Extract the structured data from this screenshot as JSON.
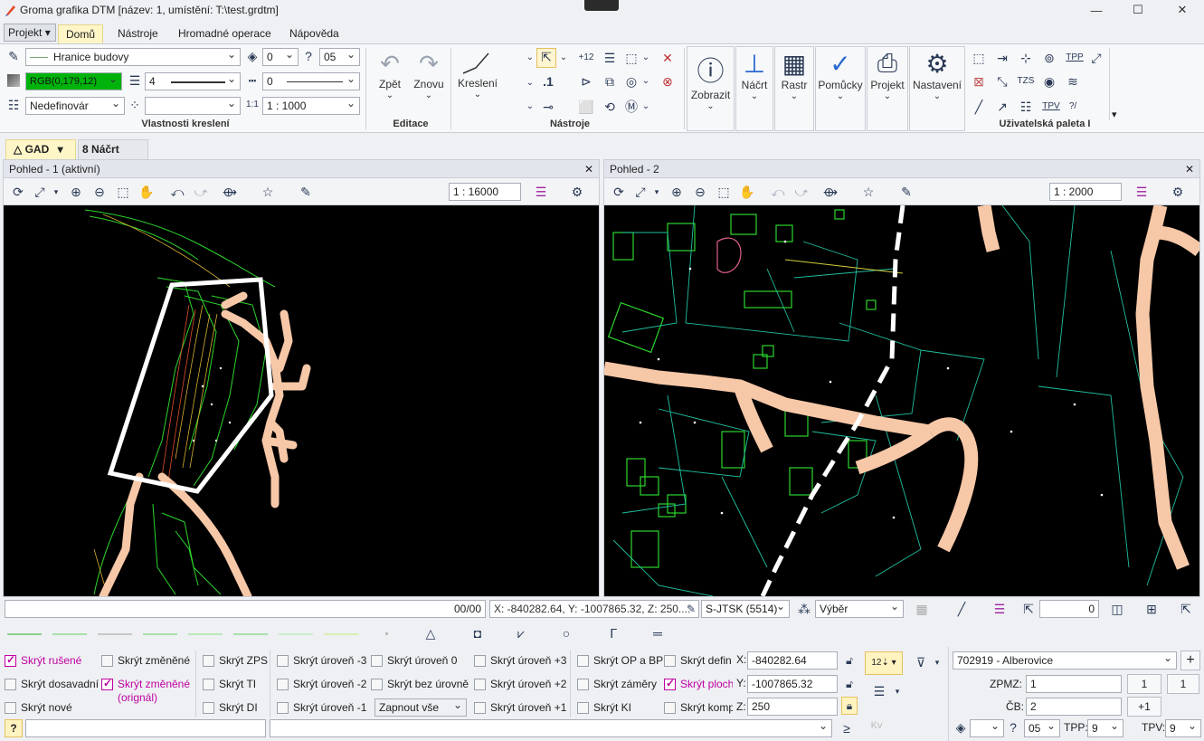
{
  "window": {
    "title": "Groma grafika DTM [název: 1, umístění: T:\\test.grdtm]",
    "minimize_icon": "minimize-icon",
    "maximize_icon": "maximize-icon",
    "close_icon": "close-icon"
  },
  "menu": {
    "projekt": "Projekt",
    "tabs": [
      "Domů",
      "Nástroje",
      "Hromadné operace",
      "Nápověda"
    ],
    "active_tab": "Domů"
  },
  "ribbon": {
    "drawing_props": {
      "layer": "Hranice budovy",
      "color": "RGB(0,179,12)",
      "color_hex": "#00b30c",
      "line_width": "4",
      "fill": "Nedefinovár",
      "num1": "0",
      "num2": "05",
      "num3": "0",
      "scale": "1 : 1000",
      "group_label": "Vlastnosti kreslení"
    },
    "editing": {
      "undo": "Zpět",
      "redo": "Znovu",
      "group_label": "Editace"
    },
    "drawing": {
      "kresleni": "Kreslení"
    },
    "tools": {
      "group_label": "Nástroje"
    },
    "big_buttons": [
      "Zobrazit",
      "Náčrt",
      "Rastr",
      "Pomůcky",
      "Projekt",
      "Nastavení"
    ],
    "palette": {
      "group_label": "Uživatelská paleta I",
      "tpp": "TPP",
      "tpv": "TPV"
    }
  },
  "doc_tabs": [
    "GAD",
    "Náčrt"
  ],
  "views": [
    {
      "title": "Pohled - 1 (aktivní)",
      "scale": "1 : 16000"
    },
    {
      "title": "Pohled - 2",
      "scale": "1 : 2000"
    }
  ],
  "status": {
    "counter": "00/00",
    "coords": "X: -840282.64, Y: -1007865.32, Z: 250....",
    "crs": "S-JTSK (5514)",
    "mode": "Výběr",
    "count": "0"
  },
  "filters": {
    "col1": [
      {
        "label": "Skrýt rušené",
        "checked": true
      },
      {
        "label": "Skrýt dosavadní",
        "checked": false
      },
      {
        "label": "Skrýt nové",
        "checked": false
      }
    ],
    "col2": [
      {
        "label": "Skrýt změněné",
        "checked": false
      },
      {
        "label": "Skrýt změněné (orignál)",
        "checked": true
      }
    ],
    "col3": [
      {
        "label": "Skrýt ZPS",
        "checked": false
      },
      {
        "label": "Skrýt TI",
        "checked": false
      },
      {
        "label": "Skrýt DI",
        "checked": false
      }
    ],
    "col4": [
      {
        "label": "Skrýt úroveň -3",
        "checked": false
      },
      {
        "label": "Skrýt úroveň -2",
        "checked": false
      },
      {
        "label": "Skrýt úroveň -1",
        "checked": false
      }
    ],
    "col5": [
      {
        "label": "Skrýt úroveň 0",
        "checked": false
      },
      {
        "label": "Skrýt bez úrovně",
        "checked": false
      }
    ],
    "zapnout": "Zapnout vše",
    "col6": [
      {
        "label": "Skrýt úroveň +3",
        "checked": false
      },
      {
        "label": "Skrýt úroveň +2",
        "checked": false
      },
      {
        "label": "Skrýt úroveň +1",
        "checked": false
      }
    ],
    "col7": [
      {
        "label": "Skrýt OP a BP",
        "checked": false
      },
      {
        "label": "Skrýt záměry",
        "checked": false
      },
      {
        "label": "Skrýt KI",
        "checked": false
      }
    ],
    "col8": [
      {
        "label": "Skrýt defin",
        "checked": false
      },
      {
        "label": "Skrýt ploch",
        "checked": true
      },
      {
        "label": "Skrýt komp",
        "checked": false
      }
    ]
  },
  "coords_panel": {
    "x_label": "X:",
    "x": "-840282.64",
    "y_label": "Y:",
    "y": "-1007865.32",
    "z_label": "Z:",
    "z": "250"
  },
  "right_panel": {
    "locality": "702919 - Alberovice",
    "zpmz_label": "ZPMZ:",
    "zpmz": "1",
    "cb_label": "ČB:",
    "cb": "2",
    "btn1": "1",
    "btn2": "1",
    "btn3": "+1",
    "bottom_num1": "05",
    "tpp_label": "TPP:",
    "tpp": "9",
    "tpv_label": "TPV:",
    "tpv": "9"
  },
  "help": "?"
}
